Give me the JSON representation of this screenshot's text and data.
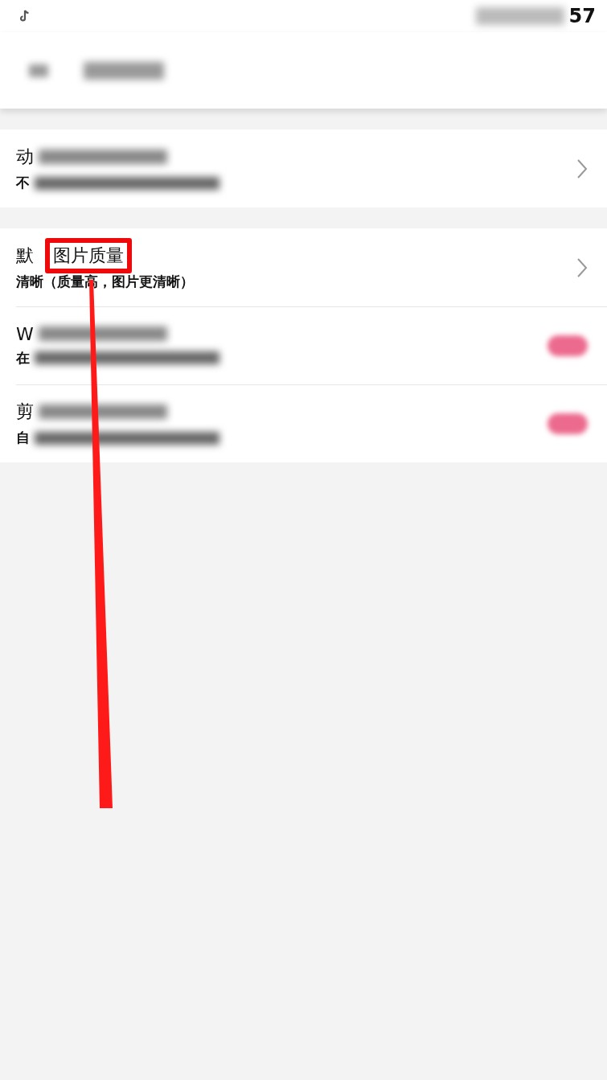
{
  "status_bar": {
    "time": "57"
  },
  "sections": [
    {
      "rows": [
        {
          "kind": "arrow",
          "title": "动",
          "subtitle": "不",
          "redacted": true
        }
      ]
    },
    {
      "rows": [
        {
          "kind": "arrow",
          "title": "默",
          "highlight": "图片质量",
          "subtitle": "清晰（质量高，图片更清晰）",
          "redacted": false
        },
        {
          "kind": "toggle",
          "title": "W",
          "subtitle": "在",
          "redacted": true,
          "on": true
        },
        {
          "kind": "toggle",
          "title": "剪",
          "subtitle": "自",
          "redacted": true,
          "on": true
        }
      ]
    }
  ]
}
